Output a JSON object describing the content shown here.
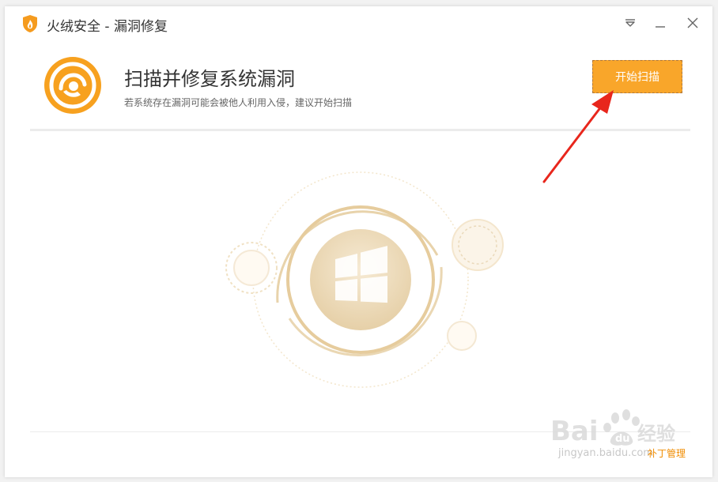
{
  "window": {
    "title": "火绒安全 - 漏洞修复"
  },
  "header": {
    "title": "扫描并修复系统漏洞",
    "subtitle": "若系统存在漏洞可能会被他人利用入侵，建议开始扫描",
    "start_button_label": "开始扫描"
  },
  "footer": {
    "patch_link_label": "补丁管理"
  },
  "watermark": {
    "brand": "Bai du 经验",
    "url": "jingyan.baidu.com"
  },
  "colors": {
    "accent": "#f9a62a",
    "accent_dark": "#f08c00",
    "arrow": "#e8261c",
    "illustration": "#e7cfa3"
  },
  "icons": {
    "app_logo": "fire-shield-icon",
    "header": "vulnerability-scan-icon",
    "menu": "dropdown-menu-icon",
    "minimize": "minimize-icon",
    "close": "close-icon",
    "center": "windows-logo-icon"
  }
}
